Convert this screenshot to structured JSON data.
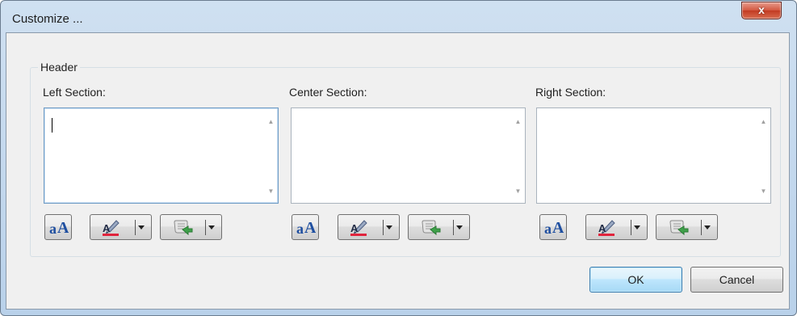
{
  "window": {
    "title": "Customize ...",
    "close_glyph": "x"
  },
  "header_group": {
    "legend": "Header",
    "sections": [
      {
        "label": "Left Section:",
        "value": ""
      },
      {
        "label": "Center Section:",
        "value": ""
      },
      {
        "label": "Right Section:",
        "value": ""
      }
    ],
    "toolbar_icons": [
      "format-text-icon",
      "text-color-icon",
      "insert-field-icon"
    ]
  },
  "buttons": {
    "ok": "OK",
    "cancel": "Cancel"
  },
  "colors": {
    "accent": "#3c7fb1",
    "close_red": "#c23a22",
    "font_blue": "#1f4fa0",
    "color_underline": "#e0243c"
  }
}
